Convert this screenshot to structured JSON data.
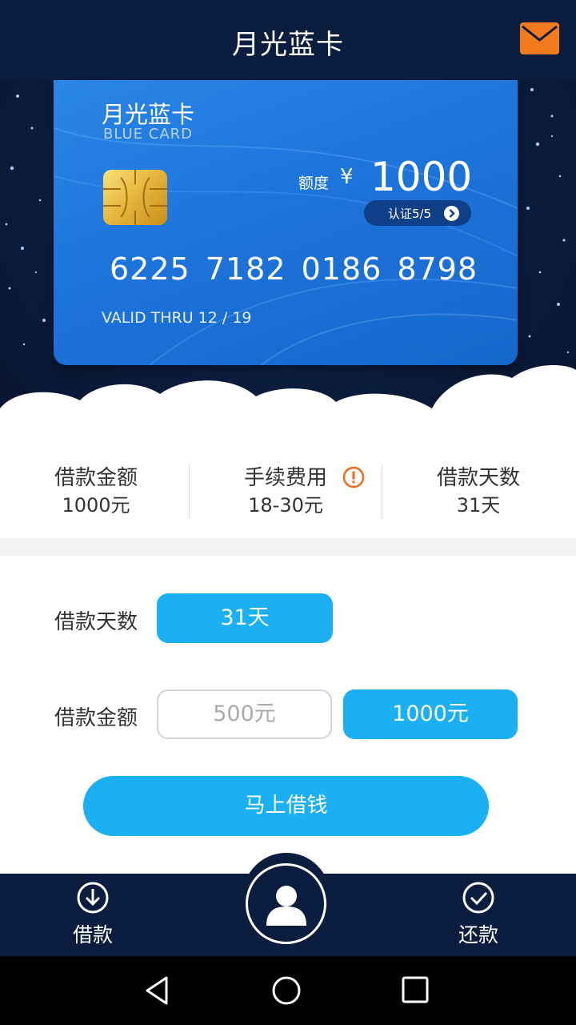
{
  "header": {
    "title": "月光蓝卡",
    "mail_icon": "mail-icon",
    "accent_color": "#f47a1e"
  },
  "card": {
    "brand": "月光蓝卡",
    "brand_en": "BLUE CARD",
    "limit_label": "额度",
    "currency": "¥",
    "limit_value": "1000",
    "verify_text": "认证5/5",
    "number": "6225  7182  0186  8798",
    "valid_thru": "VALID THRU 12 / 19"
  },
  "info": {
    "amount_label": "借款金额",
    "amount_value": "1000元",
    "fee_label": "手续费用",
    "fee_value": "18-30元",
    "days_label": "借款天数",
    "days_value": "31天"
  },
  "form": {
    "days_label": "借款天数",
    "days_option": "31天",
    "amount_label": "借款金额",
    "amount_options": [
      "500元",
      "1000元"
    ],
    "selected_amount": "1000元",
    "submit_label": "马上借钱",
    "active_color": "#1ab0f3"
  },
  "bottom_nav": {
    "left_label": "借款",
    "right_label": "还款",
    "center_icon": "user-icon"
  }
}
